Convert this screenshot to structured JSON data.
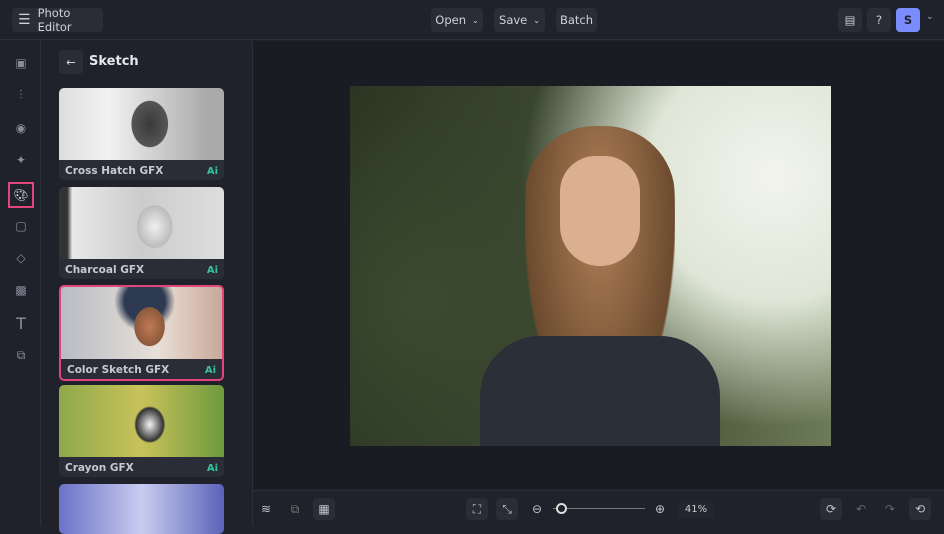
{
  "app": {
    "title": "Photo Editor"
  },
  "toolbar": {
    "open": "Open",
    "save": "Save",
    "batch": "Batch",
    "avatar_initial": "S",
    "accent": "#7b8cff"
  },
  "sidebar": {
    "icons": [
      "image-icon",
      "adjust-sliders-icon",
      "eye-icon",
      "sparkle-effects-icon",
      "artsy-palette-icon",
      "frame-icon",
      "graphics-shapes-icon",
      "textures-icon",
      "text-icon",
      "overlay-icon"
    ],
    "active": "artsy-palette-icon"
  },
  "panel": {
    "title": "Sketch",
    "cards": [
      {
        "label": "Cross Hatch GFX",
        "badge": "Ai"
      },
      {
        "label": "Charcoal GFX",
        "badge": "Ai"
      },
      {
        "label": "Color Sketch GFX",
        "badge": "Ai",
        "selected": true
      },
      {
        "label": "Crayon GFX",
        "badge": "Ai"
      }
    ]
  },
  "bottom": {
    "zoom": "41%",
    "zoom_slider_fraction": 0.05
  }
}
